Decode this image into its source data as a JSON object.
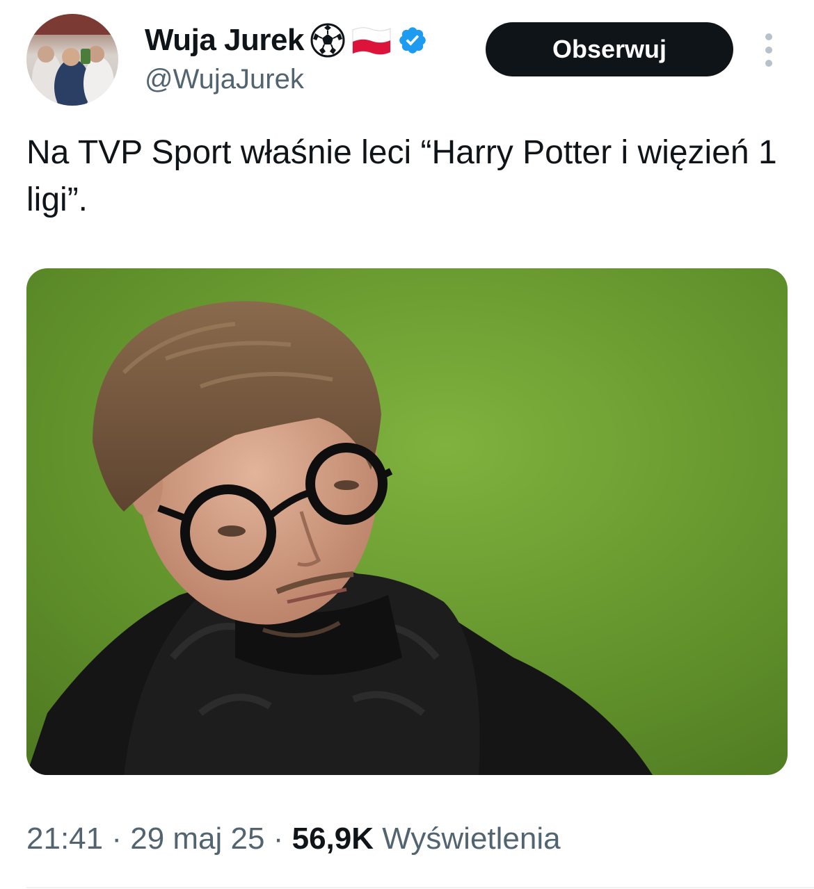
{
  "author": {
    "display_name": "Wuja Jurek",
    "handle": "@WujaJurek",
    "badges": [
      "soccer-ball-icon",
      "poland-flag-icon",
      "verified-badge-icon"
    ]
  },
  "actions": {
    "follow_label": "Obserwuj"
  },
  "tweet": {
    "text": "Na TVP Sport właśnie leci “Harry Potter i więzień 1 ligi”.",
    "time": "21:41",
    "separator_1": "·",
    "date": "29 maj 25",
    "separator_2": "·",
    "views_count": "56,9K",
    "views_label": "Wyświetlenia"
  },
  "colors": {
    "text_primary": "#0f1419",
    "text_secondary": "#536471",
    "verified_blue": "#1d9bf0",
    "button_bg": "#0f1419"
  }
}
